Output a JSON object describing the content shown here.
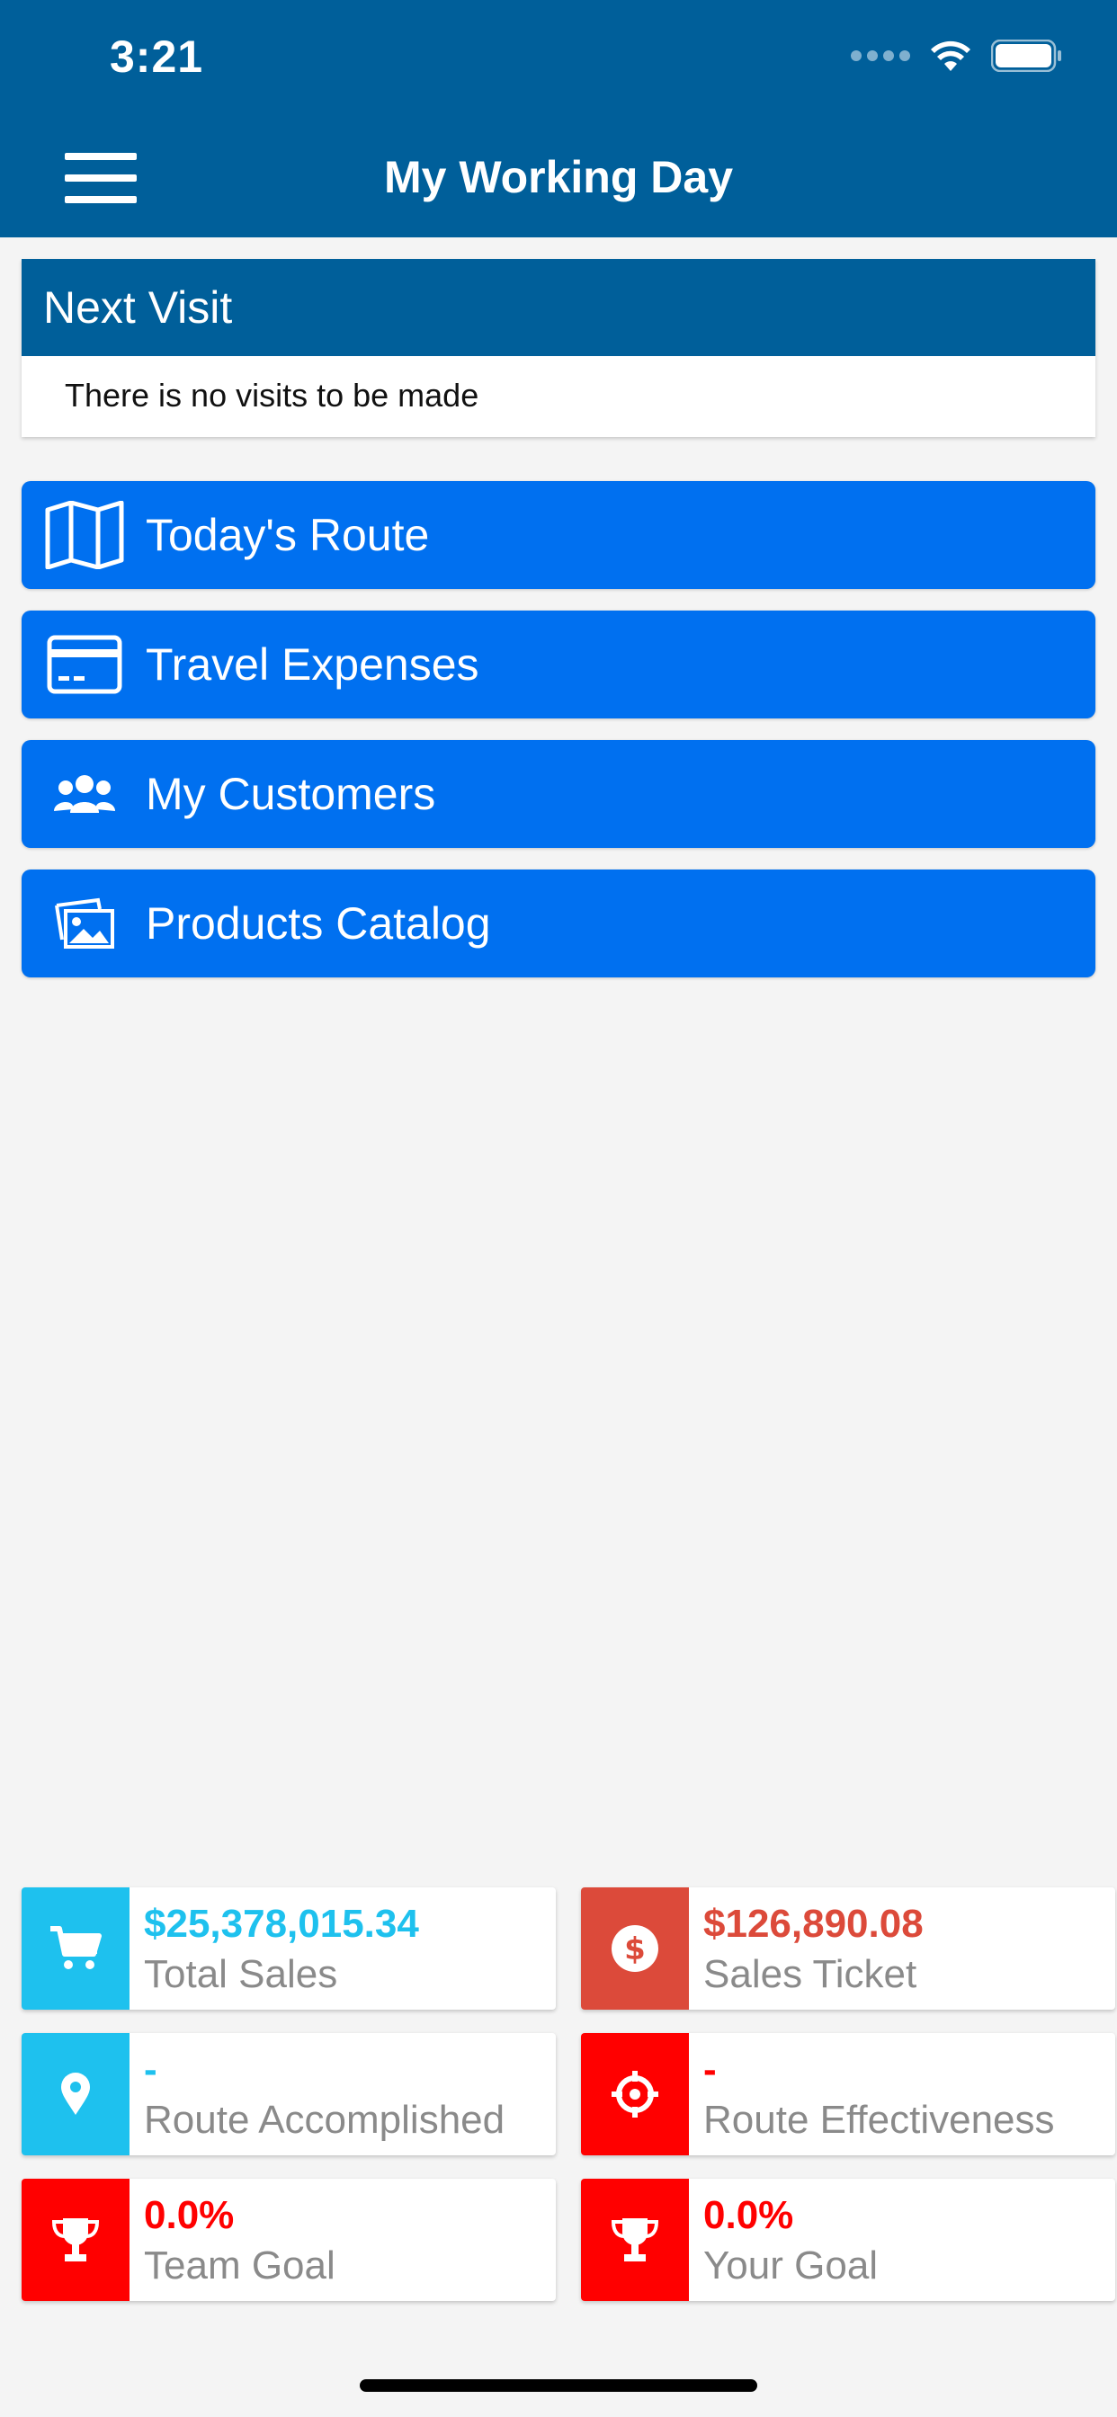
{
  "status_bar": {
    "time": "3:21"
  },
  "header": {
    "title": "My Working Day"
  },
  "next_visit": {
    "title": "Next Visit",
    "message": "There is no visits to be made"
  },
  "nav": [
    {
      "label": "Today's Route",
      "icon": "map-icon"
    },
    {
      "label": "Travel Expenses",
      "icon": "credit-card-icon"
    },
    {
      "label": "My Customers",
      "icon": "users-icon"
    },
    {
      "label": "Products Catalog",
      "icon": "images-icon"
    }
  ],
  "stats": [
    {
      "value": "$25,378,015.34",
      "label": "Total Sales",
      "icon": "cart-icon",
      "color": "#1ec1ee",
      "value_color": "#1ec1ee"
    },
    {
      "value": "$126,890.08",
      "label": "Sales Ticket",
      "icon": "dollar-icon",
      "color": "#dc4a3a",
      "value_color": "#dc4a3a"
    },
    {
      "value": "-",
      "label": "Route Accomplished",
      "icon": "location-pin-icon",
      "color": "#1ec1ee",
      "value_color": "#1ec1ee"
    },
    {
      "value": "-",
      "label": "Route Effectiveness",
      "icon": "crosshair-icon",
      "color": "#ff0000",
      "value_color": "#ff0000"
    },
    {
      "value": "0.0%",
      "label": "Team Goal",
      "icon": "trophy-icon",
      "color": "#ff0000",
      "value_color": "#ff0000"
    },
    {
      "value": "0.0%",
      "label": "Your Goal",
      "icon": "trophy-icon",
      "color": "#ff0000",
      "value_color": "#ff0000"
    }
  ]
}
